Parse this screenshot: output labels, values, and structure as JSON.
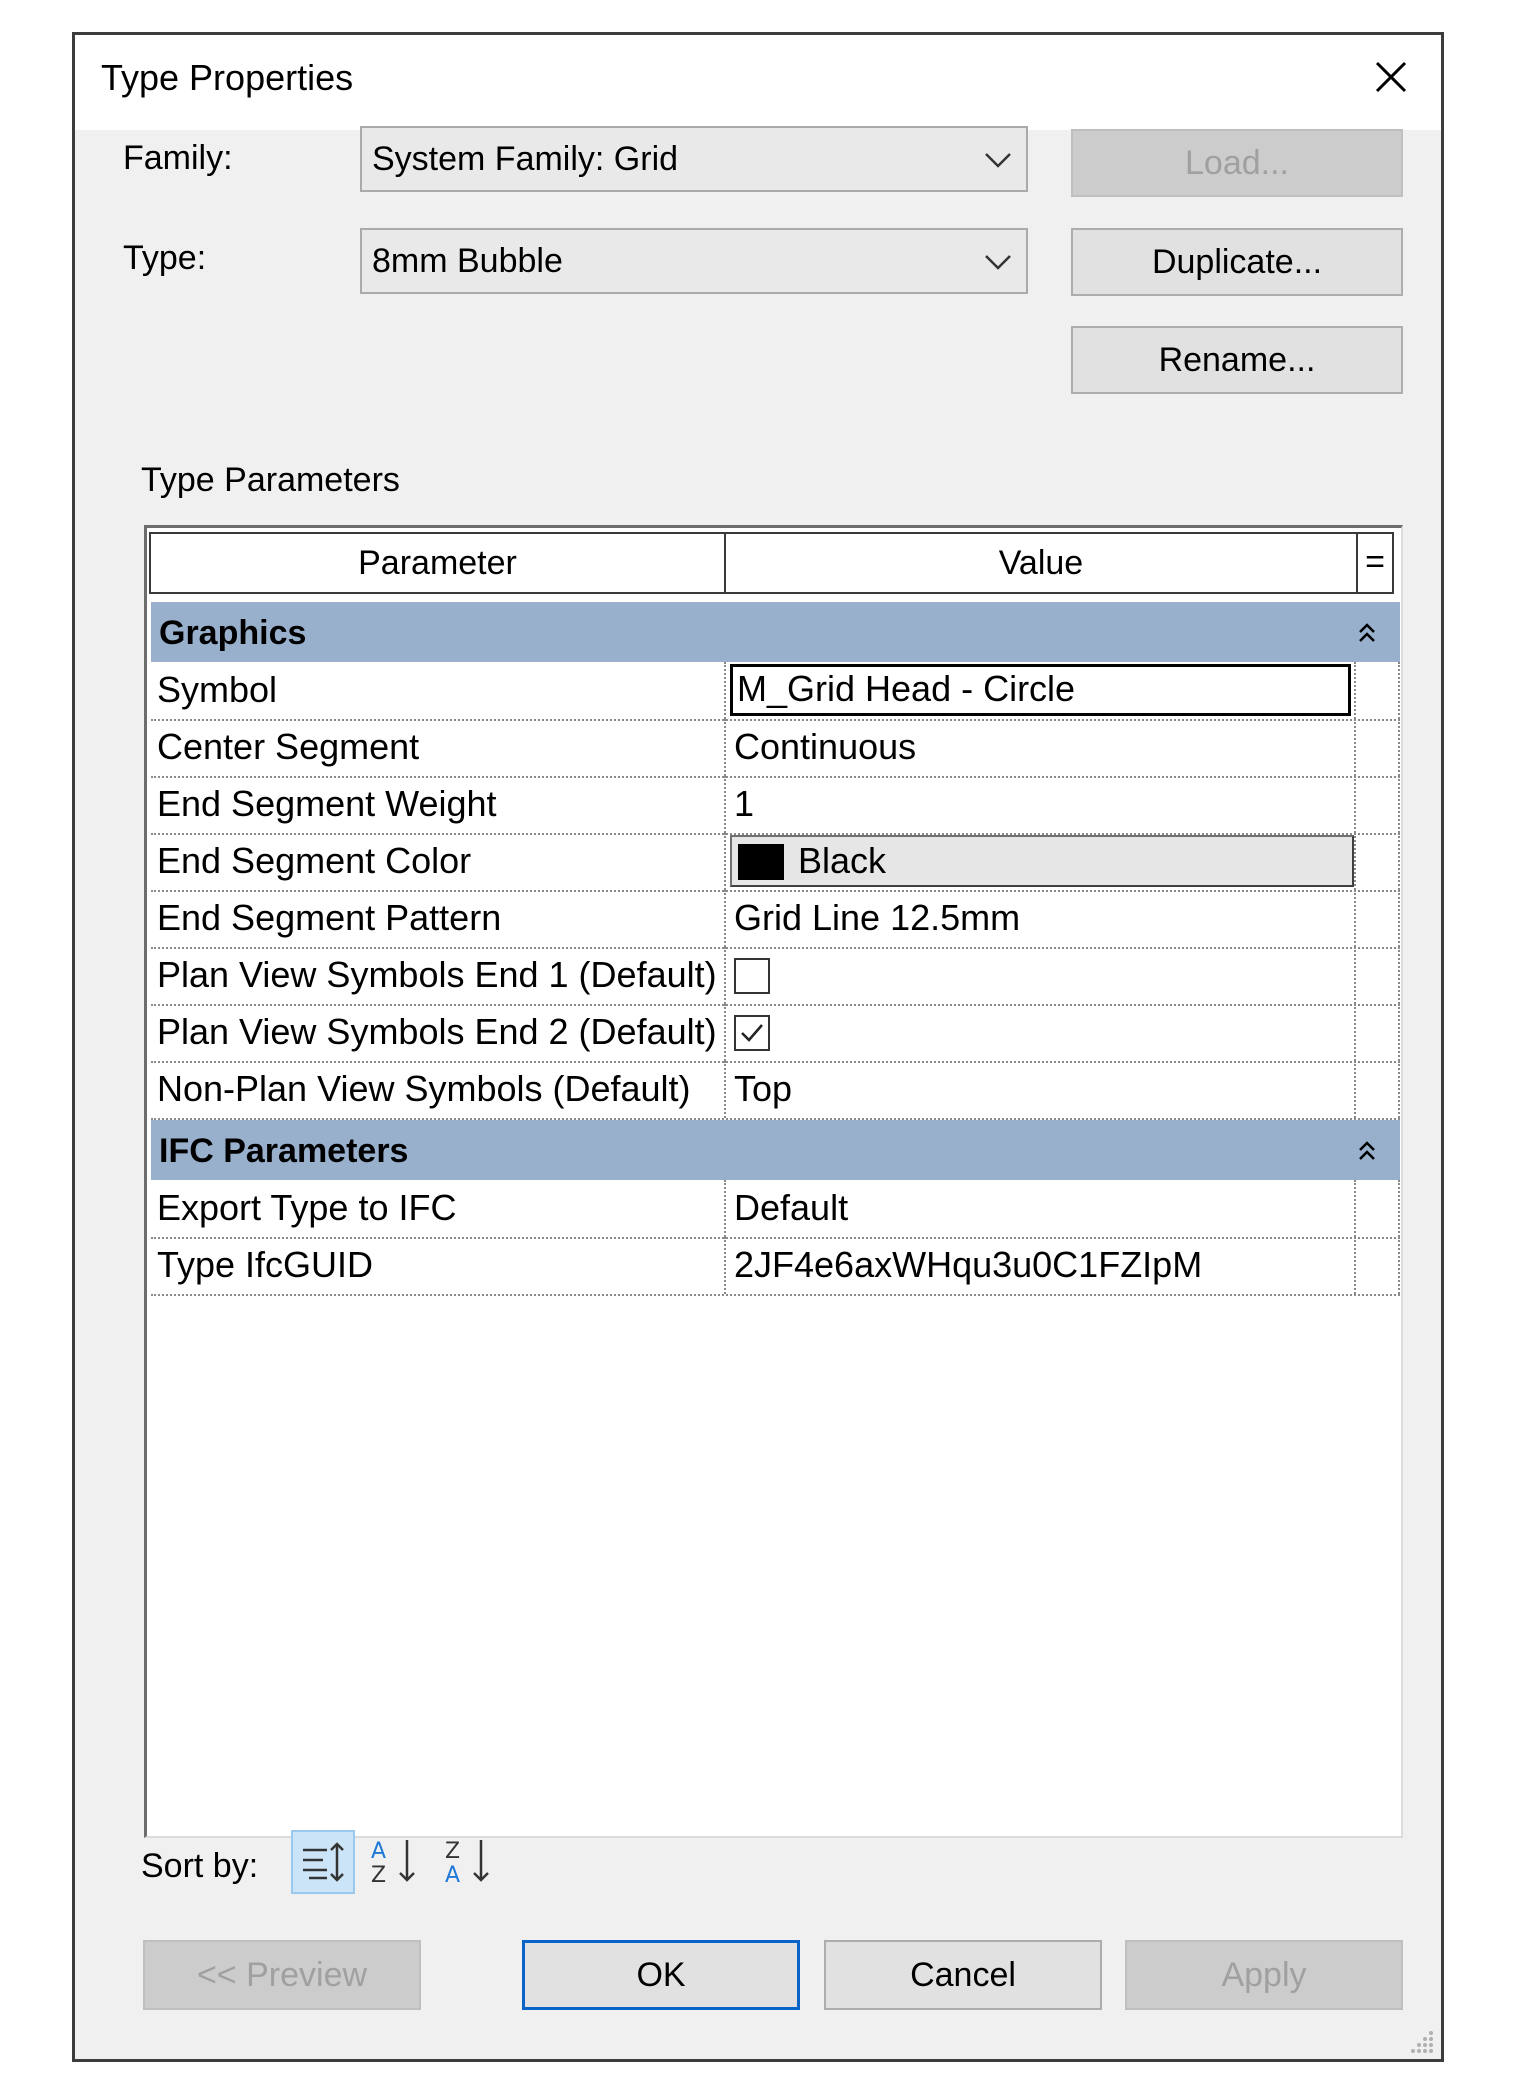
{
  "window": {
    "title": "Type Properties"
  },
  "family": {
    "label": "Family:",
    "value": "System Family: Grid",
    "load_label": "Load..."
  },
  "type": {
    "label": "Type:",
    "value": "8mm Bubble",
    "duplicate_label": "Duplicate...",
    "rename_label": "Rename..."
  },
  "parameters": {
    "section_label": "Type Parameters",
    "col_parameter": "Parameter",
    "col_value": "Value",
    "col_formula": "=",
    "groups": [
      {
        "name": "Graphics",
        "rows": [
          {
            "name": "Symbol",
            "value": "M_Grid Head - Circle"
          },
          {
            "name": "Center Segment",
            "value": "Continuous"
          },
          {
            "name": "End Segment Weight",
            "value": "1"
          },
          {
            "name": "End Segment Color",
            "value": "Black",
            "color": "#000000"
          },
          {
            "name": "End Segment Pattern",
            "value": "Grid Line 12.5mm"
          },
          {
            "name": "Plan View Symbols End 1 (Default)",
            "checked": false
          },
          {
            "name": "Plan View Symbols End 2 (Default)",
            "checked": true
          },
          {
            "name": "Non-Plan View Symbols (Default)",
            "value": "Top"
          }
        ]
      },
      {
        "name": "IFC Parameters",
        "rows": [
          {
            "name": "Export Type to IFC",
            "value": "Default"
          },
          {
            "name": "Type IfcGUID",
            "value": "2JF4e6axWHqu3u0C1FZIpM"
          }
        ]
      }
    ]
  },
  "sort": {
    "label": "Sort by:",
    "icons": [
      "group-sort-icon",
      "sort-ascending-icon",
      "sort-descending-icon"
    ]
  },
  "footer": {
    "preview_label": "<< Preview",
    "ok_label": "OK",
    "cancel_label": "Cancel",
    "apply_label": "Apply"
  },
  "colors": {
    "group_header": "#98b0cc",
    "default_button_border": "#0a64c8",
    "active_sort": "#cce4f7"
  }
}
